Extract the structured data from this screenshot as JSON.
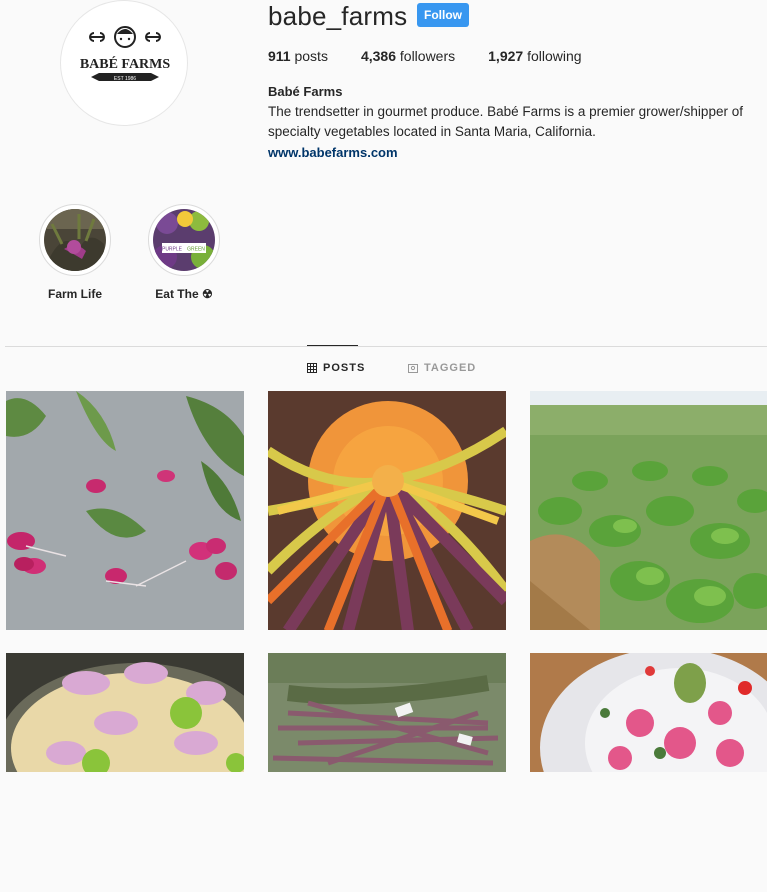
{
  "profile": {
    "username": "babe_farms",
    "follow_label": "Follow",
    "logo_text": "BABÉ FARMS",
    "logo_est": "EST 1986"
  },
  "stats": [
    {
      "value": "911",
      "label": "posts"
    },
    {
      "value": "4,386",
      "label": "followers"
    },
    {
      "value": "1,927",
      "label": "following"
    }
  ],
  "bio": {
    "name": "Babé Farms",
    "text": "The trendsetter in gourmet produce. Babé Farms is a premier grower/shipper of specialty vegetables located in Santa Maria, California.",
    "link": "www.babefarms.com"
  },
  "highlights": [
    {
      "label": "Farm Life"
    },
    {
      "label": "Eat The ☢",
      "badge_left": "PURPLE",
      "badge_right": "GREEN"
    }
  ],
  "tabs": [
    {
      "label": "POSTS",
      "icon": "grid-icon",
      "active": true
    },
    {
      "label": "TAGGED",
      "icon": "tag-icon",
      "active": false
    }
  ],
  "colors": {
    "follow_blue": "#3897f0",
    "link_blue": "#003569",
    "background": "#fafafa",
    "divider": "#dbdbdb"
  }
}
